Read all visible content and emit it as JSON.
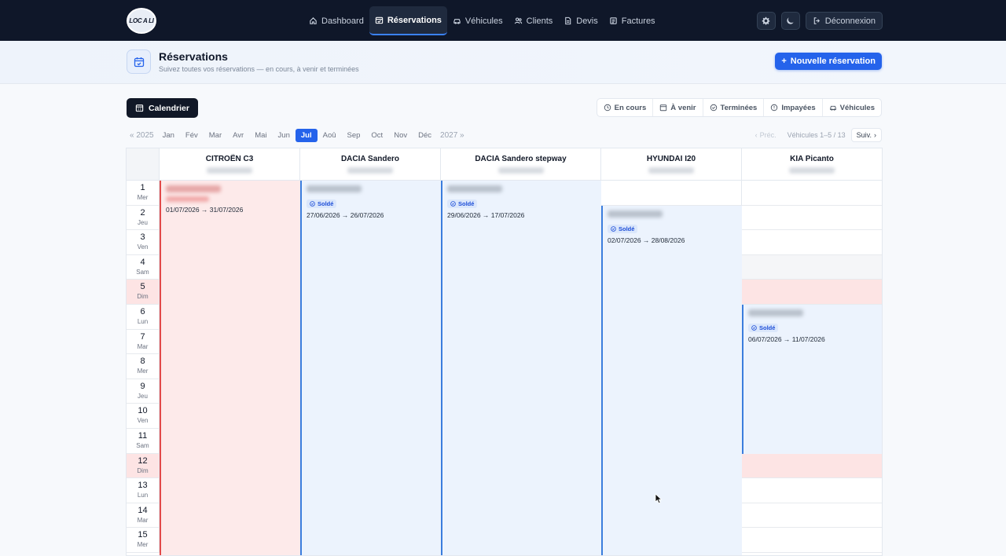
{
  "nav": {
    "logo_text": "LOC A LI",
    "links": [
      {
        "label": "Dashboard",
        "icon": "home-icon"
      },
      {
        "label": "Réservations",
        "icon": "calendar-check-icon"
      },
      {
        "label": "Véhicules",
        "icon": "car-icon"
      },
      {
        "label": "Clients",
        "icon": "users-icon"
      },
      {
        "label": "Devis",
        "icon": "file-icon"
      },
      {
        "label": "Factures",
        "icon": "receipt-icon"
      }
    ],
    "logout_label": "Déconnexion"
  },
  "header": {
    "title": "Réservations",
    "subtitle": "Suivez toutes vos réservations — en cours, à venir et terminées",
    "new_button": "Nouvelle réservation"
  },
  "toolbar": {
    "calendar_label": "Calendrier",
    "filters": [
      "En cours",
      "À venir",
      "Terminées",
      "Impayées",
      "Véhicules"
    ]
  },
  "months": {
    "prev_year": "« 2025",
    "next_year": "2027 »",
    "list": [
      "Jan",
      "Fév",
      "Mar",
      "Avr",
      "Mai",
      "Jun",
      "Jul",
      "Aoû",
      "Sep",
      "Oct",
      "Nov",
      "Déc"
    ],
    "active": "Jul"
  },
  "pager": {
    "prev": "Préc.",
    "info": "Véhicules 1–5 / 13",
    "next": "Suiv."
  },
  "vehicles": [
    "CITROËN C3",
    "DACIA Sandero",
    "DACIA Sandero stepway",
    "HYUNDAI I20",
    "KIA Picanto"
  ],
  "days": [
    {
      "n": "1",
      "d": "Mer"
    },
    {
      "n": "2",
      "d": "Jeu"
    },
    {
      "n": "3",
      "d": "Ven"
    },
    {
      "n": "4",
      "d": "Sam"
    },
    {
      "n": "5",
      "d": "Dim"
    },
    {
      "n": "6",
      "d": "Lun"
    },
    {
      "n": "7",
      "d": "Mar"
    },
    {
      "n": "8",
      "d": "Mer"
    },
    {
      "n": "9",
      "d": "Jeu"
    },
    {
      "n": "10",
      "d": "Ven"
    },
    {
      "n": "11",
      "d": "Sam"
    },
    {
      "n": "12",
      "d": "Dim"
    },
    {
      "n": "13",
      "d": "Lun"
    },
    {
      "n": "14",
      "d": "Mar"
    },
    {
      "n": "15",
      "d": "Mer"
    }
  ],
  "bookings": [
    {
      "vehicle": "CITROËN C3",
      "status": "unpaid",
      "badge": "",
      "dates": "01/07/2026 → 31/07/2026"
    },
    {
      "vehicle": "DACIA Sandero",
      "status": "paid",
      "badge": "Soldé",
      "dates": "27/06/2026 → 26/07/2026"
    },
    {
      "vehicle": "DACIA Sandero stepway",
      "status": "paid",
      "badge": "Soldé",
      "dates": "29/06/2026 → 17/07/2026"
    },
    {
      "vehicle": "HYUNDAI I20",
      "status": "paid",
      "badge": "Soldé",
      "dates": "02/07/2026 → 28/08/2026"
    },
    {
      "vehicle": "KIA Picanto",
      "status": "paid",
      "badge": "Soldé",
      "dates": "06/07/2026 → 11/07/2026"
    }
  ],
  "colors": {
    "nav_bg": "#0f1729",
    "accent": "#2563eb",
    "sunday_bg": "#fde4e4",
    "unpaid": "#e24a4a",
    "paid": "#3b7ddd"
  }
}
